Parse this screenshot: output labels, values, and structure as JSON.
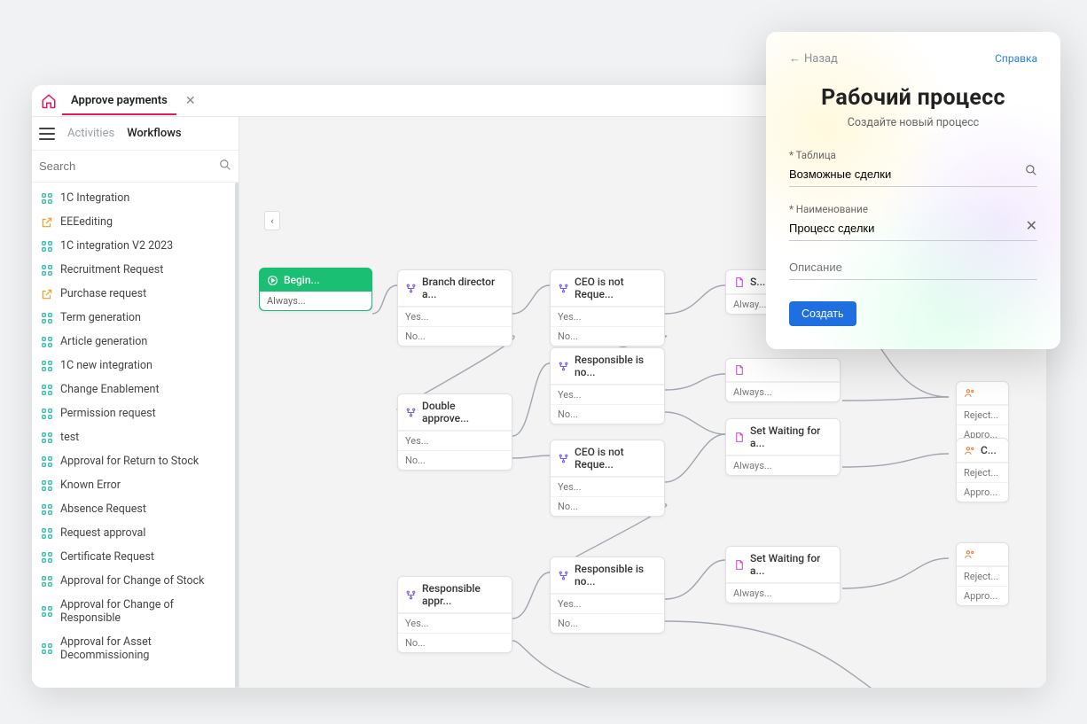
{
  "tab": {
    "title": "Approve payments"
  },
  "subtabs": {
    "activities": "Activities",
    "workflows": "Workflows"
  },
  "search": {
    "placeholder": "Search"
  },
  "workflows": [
    {
      "label": "1C Integration",
      "icon": "wf"
    },
    {
      "label": "EEEediting",
      "icon": "ext"
    },
    {
      "label": "1C integration V2 2023",
      "icon": "wf"
    },
    {
      "label": "Recruitment Request",
      "icon": "wf"
    },
    {
      "label": "Purchase request",
      "icon": "ext"
    },
    {
      "label": "Term generation",
      "icon": "wf"
    },
    {
      "label": "Article generation",
      "icon": "wf"
    },
    {
      "label": "1C new integration",
      "icon": "wf"
    },
    {
      "label": "Change Enablement",
      "icon": "wf"
    },
    {
      "label": "Permission request",
      "icon": "wf"
    },
    {
      "label": "test",
      "icon": "wf"
    },
    {
      "label": "Approval for Return to Stock",
      "icon": "wf"
    },
    {
      "label": "Known Error",
      "icon": "wf"
    },
    {
      "label": "Absence Request",
      "icon": "wf"
    },
    {
      "label": "Request approval",
      "icon": "wf"
    },
    {
      "label": "Certificate Request",
      "icon": "wf"
    },
    {
      "label": "Approval for Change of Stock",
      "icon": "wf"
    },
    {
      "label": "Approval for Change of Responsible",
      "icon": "wf"
    },
    {
      "label": "Approval for Asset Decommissioning",
      "icon": "wf"
    }
  ],
  "nodes": {
    "begin": {
      "title": "Begin...",
      "out0": "Always..."
    },
    "branch_director": {
      "title": "Branch director a...",
      "out0": "Yes...",
      "out1": "No..."
    },
    "double_approve": {
      "title": "Double approve...",
      "out0": "Yes...",
      "out1": "No..."
    },
    "responsible_appr": {
      "title": "Responsible appr...",
      "out0": "Yes...",
      "out1": "No..."
    },
    "ceo1": {
      "title": "CEO is not Reque...",
      "out0": "Yes...",
      "out1": "No..."
    },
    "resp_no1": {
      "title": "Responsible is no...",
      "out0": "Yes...",
      "out1": "No..."
    },
    "ceo2": {
      "title": "CEO is not Reque...",
      "out0": "Yes...",
      "out1": "No..."
    },
    "resp_no2": {
      "title": "Responsible is no...",
      "out0": "Yes...",
      "out1": "No..."
    },
    "s1": {
      "title": "S...",
      "out0": "Alway..."
    },
    "a1": {
      "title": "",
      "out0": "Always..."
    },
    "wait1": {
      "title": "Set Waiting for a...",
      "out0": "Always..."
    },
    "wait2": {
      "title": "Set Waiting for a...",
      "out0": "Always..."
    },
    "c1": {
      "title": "C...",
      "out0": "Reject...",
      "out1": "Appro..."
    },
    "c2": {
      "title": "C...",
      "out0": "Reject...",
      "out1": "Appro..."
    },
    "c3": {
      "title": "",
      "out0": "Reject...",
      "out1": "Appro..."
    }
  },
  "modal": {
    "back": "Назад",
    "help": "Справка",
    "title": "Рабочий процесс",
    "subtitle": "Создайте новый процесс",
    "field_table_label": "* Таблица",
    "field_table_value": "Возможные сделки",
    "field_name_label": "* Наименование",
    "field_name_value": "Процесс сделки",
    "field_desc_placeholder": "Описание",
    "button": "Создать"
  }
}
